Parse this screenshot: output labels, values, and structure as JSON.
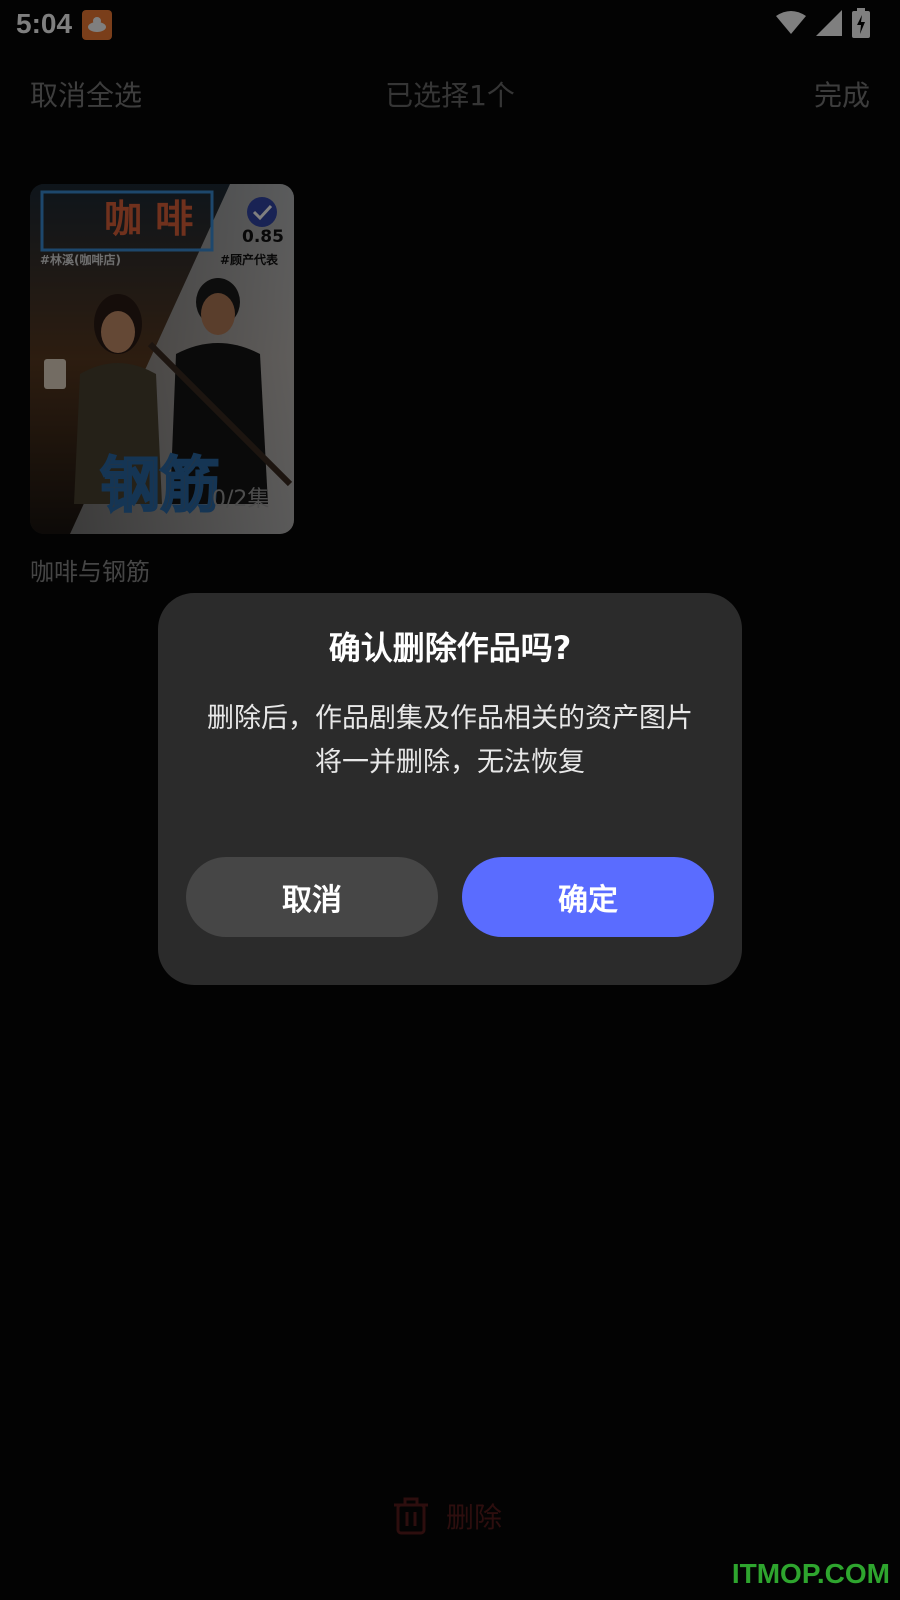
{
  "status_bar": {
    "time": "5:04"
  },
  "header": {
    "cancel_select_all": "取消全选",
    "selected_text": "已选择1个",
    "done": "完成"
  },
  "work_card": {
    "poster_title": "咖 啡",
    "poster_title_2": "钢筋",
    "tag_left": "#林溪(咖啡店)",
    "tag_right": "#顾产代表",
    "score": "0.85",
    "episodes": "0/2集",
    "title": "咖啡与钢筋",
    "selected": true
  },
  "dialog": {
    "title": "确认删除作品吗?",
    "message": "删除后，作品剧集及作品相关的资产图片将一并删除，无法恢复",
    "cancel_label": "取消",
    "confirm_label": "确定"
  },
  "bottom_bar": {
    "delete_label": "删除"
  },
  "watermark": "ITMOP.COM",
  "colors": {
    "confirm": "#5a6cff",
    "dialog_bg": "#2b2b2b",
    "delete": "#5a1d1d"
  }
}
